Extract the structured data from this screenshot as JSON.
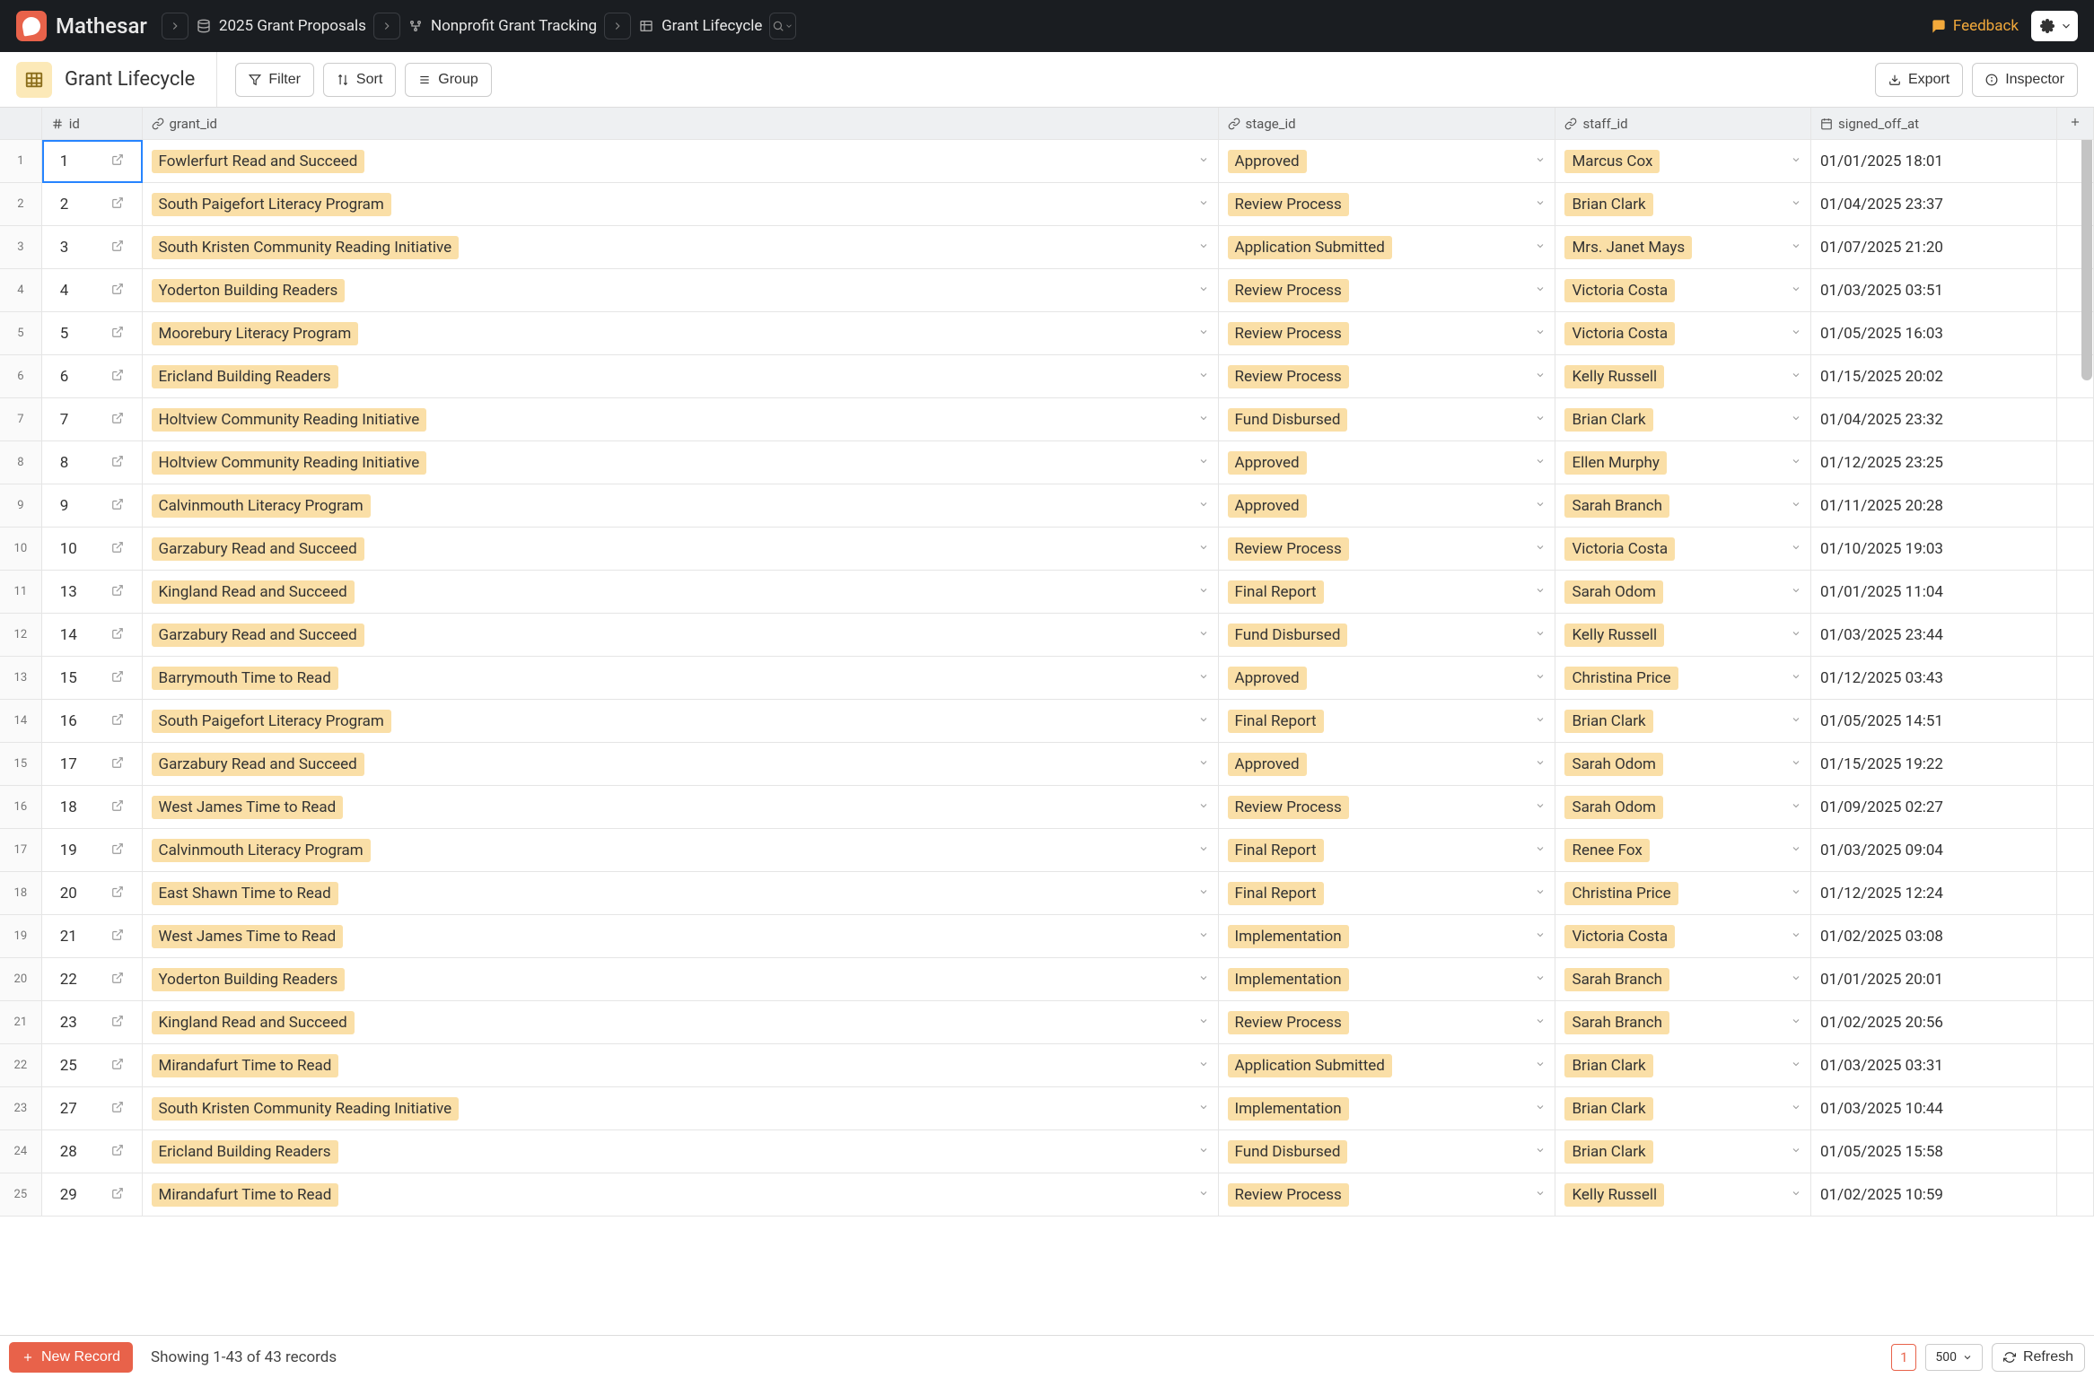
{
  "brand": "Mathesar",
  "breadcrumbs": [
    {
      "icon": "database",
      "label": "2025 Grant Proposals"
    },
    {
      "icon": "schema",
      "label": "Nonprofit Grant Tracking"
    },
    {
      "icon": "table",
      "label": "Grant Lifecycle"
    }
  ],
  "feedback_label": "Feedback",
  "page_title": "Grant Lifecycle",
  "toolbar": {
    "filter": "Filter",
    "sort": "Sort",
    "group": "Group",
    "export": "Export",
    "inspector": "Inspector"
  },
  "columns": {
    "id": "id",
    "grant_id": "grant_id",
    "stage_id": "stage_id",
    "staff_id": "staff_id",
    "signed_off_at": "signed_off_at"
  },
  "rows": [
    {
      "n": 1,
      "id": "1",
      "grant": "Fowlerfurt Read and Succeed",
      "stage": "Approved",
      "staff": "Marcus Cox",
      "signed": "01/01/2025 18:01"
    },
    {
      "n": 2,
      "id": "2",
      "grant": "South Paigefort Literacy Program",
      "stage": "Review Process",
      "staff": "Brian Clark",
      "signed": "01/04/2025 23:37"
    },
    {
      "n": 3,
      "id": "3",
      "grant": "South Kristen Community Reading Initiative",
      "stage": "Application Submitted",
      "staff": "Mrs. Janet Mays",
      "signed": "01/07/2025 21:20"
    },
    {
      "n": 4,
      "id": "4",
      "grant": "Yoderton Building Readers",
      "stage": "Review Process",
      "staff": "Victoria Costa",
      "signed": "01/03/2025 03:51"
    },
    {
      "n": 5,
      "id": "5",
      "grant": "Moorebury Literacy Program",
      "stage": "Review Process",
      "staff": "Victoria Costa",
      "signed": "01/05/2025 16:03"
    },
    {
      "n": 6,
      "id": "6",
      "grant": "Ericland Building Readers",
      "stage": "Review Process",
      "staff": "Kelly Russell",
      "signed": "01/15/2025 20:02"
    },
    {
      "n": 7,
      "id": "7",
      "grant": "Holtview Community Reading Initiative",
      "stage": "Fund Disbursed",
      "staff": "Brian Clark",
      "signed": "01/04/2025 23:32"
    },
    {
      "n": 8,
      "id": "8",
      "grant": "Holtview Community Reading Initiative",
      "stage": "Approved",
      "staff": "Ellen Murphy",
      "signed": "01/12/2025 23:25"
    },
    {
      "n": 9,
      "id": "9",
      "grant": "Calvinmouth Literacy Program",
      "stage": "Approved",
      "staff": "Sarah Branch",
      "signed": "01/11/2025 20:28"
    },
    {
      "n": 10,
      "id": "10",
      "grant": "Garzabury Read and Succeed",
      "stage": "Review Process",
      "staff": "Victoria Costa",
      "signed": "01/10/2025 19:03"
    },
    {
      "n": 11,
      "id": "13",
      "grant": "Kingland Read and Succeed",
      "stage": "Final Report",
      "staff": "Sarah Odom",
      "signed": "01/01/2025 11:04"
    },
    {
      "n": 12,
      "id": "14",
      "grant": "Garzabury Read and Succeed",
      "stage": "Fund Disbursed",
      "staff": "Kelly Russell",
      "signed": "01/03/2025 23:44"
    },
    {
      "n": 13,
      "id": "15",
      "grant": "Barrymouth Time to Read",
      "stage": "Approved",
      "staff": "Christina Price",
      "signed": "01/12/2025 03:43"
    },
    {
      "n": 14,
      "id": "16",
      "grant": "South Paigefort Literacy Program",
      "stage": "Final Report",
      "staff": "Brian Clark",
      "signed": "01/05/2025 14:51"
    },
    {
      "n": 15,
      "id": "17",
      "grant": "Garzabury Read and Succeed",
      "stage": "Approved",
      "staff": "Sarah Odom",
      "signed": "01/15/2025 19:22"
    },
    {
      "n": 16,
      "id": "18",
      "grant": "West James Time to Read",
      "stage": "Review Process",
      "staff": "Sarah Odom",
      "signed": "01/09/2025 02:27"
    },
    {
      "n": 17,
      "id": "19",
      "grant": "Calvinmouth Literacy Program",
      "stage": "Final Report",
      "staff": "Renee Fox",
      "signed": "01/03/2025 09:04"
    },
    {
      "n": 18,
      "id": "20",
      "grant": "East Shawn Time to Read",
      "stage": "Final Report",
      "staff": "Christina Price",
      "signed": "01/12/2025 12:24"
    },
    {
      "n": 19,
      "id": "21",
      "grant": "West James Time to Read",
      "stage": "Implementation",
      "staff": "Victoria Costa",
      "signed": "01/02/2025 03:08"
    },
    {
      "n": 20,
      "id": "22",
      "grant": "Yoderton Building Readers",
      "stage": "Implementation",
      "staff": "Sarah Branch",
      "signed": "01/01/2025 20:01"
    },
    {
      "n": 21,
      "id": "23",
      "grant": "Kingland Read and Succeed",
      "stage": "Review Process",
      "staff": "Sarah Branch",
      "signed": "01/02/2025 20:56"
    },
    {
      "n": 22,
      "id": "25",
      "grant": "Mirandafurt Time to Read",
      "stage": "Application Submitted",
      "staff": "Brian Clark",
      "signed": "01/03/2025 03:31"
    },
    {
      "n": 23,
      "id": "27",
      "grant": "South Kristen Community Reading Initiative",
      "stage": "Implementation",
      "staff": "Brian Clark",
      "signed": "01/03/2025 10:44"
    },
    {
      "n": 24,
      "id": "28",
      "grant": "Ericland Building Readers",
      "stage": "Fund Disbursed",
      "staff": "Brian Clark",
      "signed": "01/05/2025 15:58"
    },
    {
      "n": 25,
      "id": "29",
      "grant": "Mirandafurt Time to Read",
      "stage": "Review Process",
      "staff": "Kelly Russell",
      "signed": "01/02/2025 10:59"
    }
  ],
  "footer": {
    "new_record": "New Record",
    "status": "Showing 1-43 of 43 records",
    "page": "1",
    "per_page": "500",
    "refresh": "Refresh"
  }
}
